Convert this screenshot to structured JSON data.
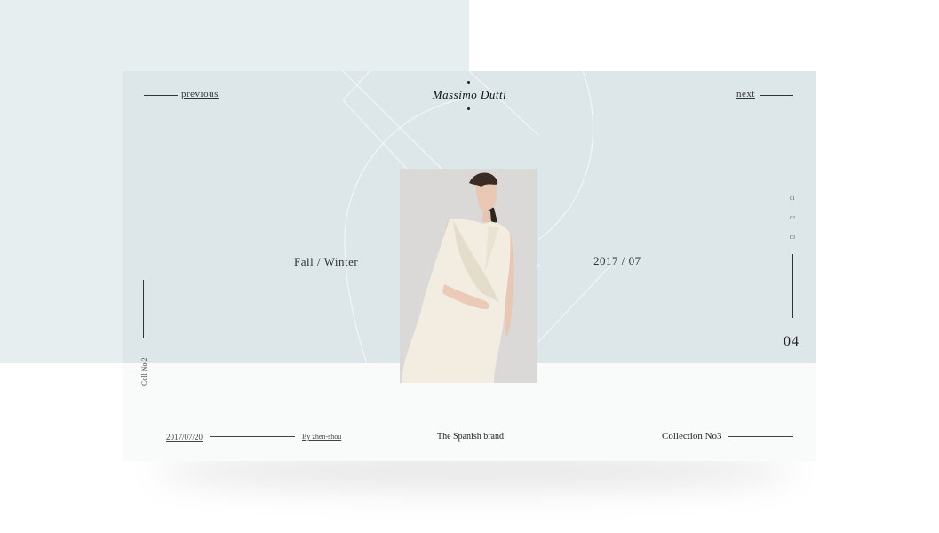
{
  "nav": {
    "previous": "previous",
    "next": "next"
  },
  "brand": {
    "name": "Massimo Dutti"
  },
  "hero": {
    "season": "Fall / Winter",
    "date": "2017 / 07"
  },
  "pager": {
    "items": [
      "01",
      "02",
      "03"
    ],
    "current": "04"
  },
  "collection_label": "Coll No.2",
  "footer": {
    "date": "2017/07/20",
    "author": "By zhen-shou",
    "tagline": "The Spanish brand",
    "collection": "Collection No3"
  },
  "colors": {
    "panel": "#e6eef0",
    "card_top": "#dde7e9",
    "card_bottom": "#f9fafa"
  },
  "photo": {
    "alt": "model in cream sleeveless wrap dress"
  }
}
